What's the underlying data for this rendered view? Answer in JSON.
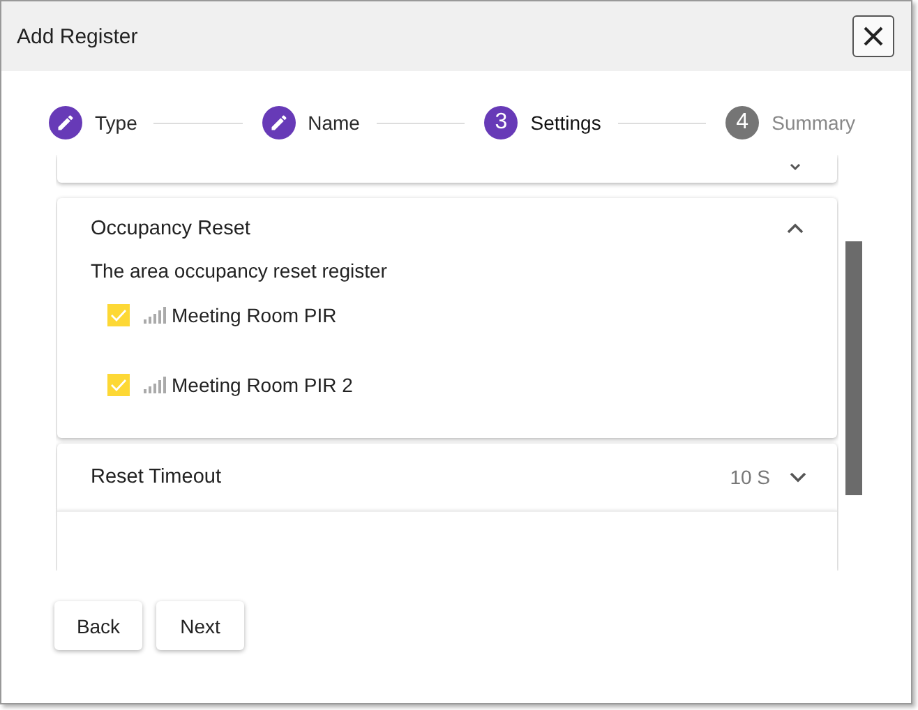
{
  "window": {
    "title": "Add Register"
  },
  "steps": [
    {
      "label": "Type",
      "completed": true,
      "selected": false
    },
    {
      "label": "Name",
      "completed": true,
      "selected": false
    },
    {
      "label": "Settings",
      "number": "3",
      "completed": false,
      "selected": true
    },
    {
      "label": "Summary",
      "number": "4",
      "completed": false,
      "selected": false
    }
  ],
  "panels": [
    {
      "kind": "cut",
      "expanded": false
    },
    {
      "kind": "list",
      "title": "Occupancy Reset",
      "expanded": true,
      "description": "The area occupancy reset register",
      "items": [
        {
          "label": "Meeting Room PIR",
          "checked": true
        },
        {
          "label": "Meeting Room PIR 2",
          "checked": true
        }
      ]
    },
    {
      "kind": "value",
      "title": "Reset Timeout",
      "value": "10 S",
      "expanded": false
    }
  ],
  "buttons": [
    "Back",
    "Next"
  ]
}
